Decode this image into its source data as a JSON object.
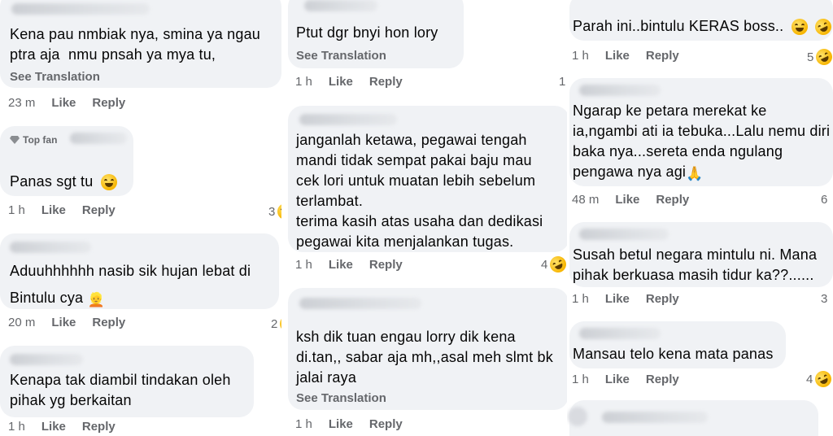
{
  "col1": {
    "c1": {
      "lines": [
        "Kena pau nmbiak nya, smina ya ngau",
        "ptra aja  nmu pnsah ya mya tu,"
      ],
      "see_translation": "See Translation",
      "time": "23 m",
      "like": "Like",
      "reply": "Reply"
    },
    "c2": {
      "badge": "Top fan",
      "text": "Panas sgt tu",
      "time": "1 h",
      "like": "Like",
      "reply": "Reply",
      "reaction_count": "3"
    },
    "c3": {
      "lines": [
        "Aduuhhhhhh nasib sik hujan lebat di",
        "Bintulu cya"
      ],
      "time": "20 m",
      "like": "Like",
      "reply": "Reply",
      "reaction_count": "2"
    },
    "c4": {
      "lines": [
        "Kenapa tak diambil tindakan oleh",
        "pihak yg berkaitan"
      ],
      "time": "1 h",
      "like": "Like",
      "reply": "Reply"
    }
  },
  "col2": {
    "c1": {
      "text": "Ptut dgr bnyi hon lory",
      "see_translation": "See Translation",
      "time": "1 h",
      "like": "Like",
      "reply": "Reply",
      "reaction_count": "1"
    },
    "c2": {
      "lines": [
        "janganlah ketawa, pegawai tengah",
        "mandi tidak sempat pakai baju mau",
        "cek lori untuk muatan lebih sebelum",
        "terlambat.",
        "terima kasih atas usaha dan dedikasi",
        "pegawai kita menjalankan tugas."
      ],
      "time": "1 h",
      "like": "Like",
      "reply": "Reply",
      "reaction_count": "4"
    },
    "c3": {
      "lines": [
        "ksh dik tuan engau lorry dik kena",
        "di.tan,, sabar aja mh,,asal meh slmt bk",
        "jalai raya"
      ],
      "see_translation": "See Translation",
      "time": "1 h",
      "like": "Like",
      "reply": "Reply"
    }
  },
  "col3": {
    "c1": {
      "text": "Parah ini..bintulu KERAS boss..",
      "time": "1 h",
      "like": "Like",
      "reply": "Reply",
      "reaction_count": "5"
    },
    "c2": {
      "lines": [
        "Ngarap ke petara merekat ke",
        "ia,ngambi ati ia tebuka...Lalu nemu diri",
        "baka nya...sereta enda ngulang",
        "pengawa nya agi"
      ],
      "time": "48 m",
      "like": "Like",
      "reply": "Reply",
      "reaction_count": "6"
    },
    "c3": {
      "lines": [
        "Susah betul negara mintulu ni. Mana",
        "pihak berkuasa masih tidur ka??......"
      ],
      "time": "1 h",
      "like": "Like",
      "reply": "Reply",
      "reaction_count": "3"
    },
    "c4": {
      "text": "Mansau telo kena mata panas",
      "time": "1 h",
      "like": "Like",
      "reply": "Reply",
      "reaction_count": "4"
    }
  },
  "icons": {
    "laugh": "laughing-face-emoji",
    "rofl": "rolling-on-floor-laughing-emoji",
    "grin": "grinning-face-emoji",
    "pray": "folded-hands-emoji",
    "person": "person-emoji",
    "gem": "diamond-icon"
  }
}
